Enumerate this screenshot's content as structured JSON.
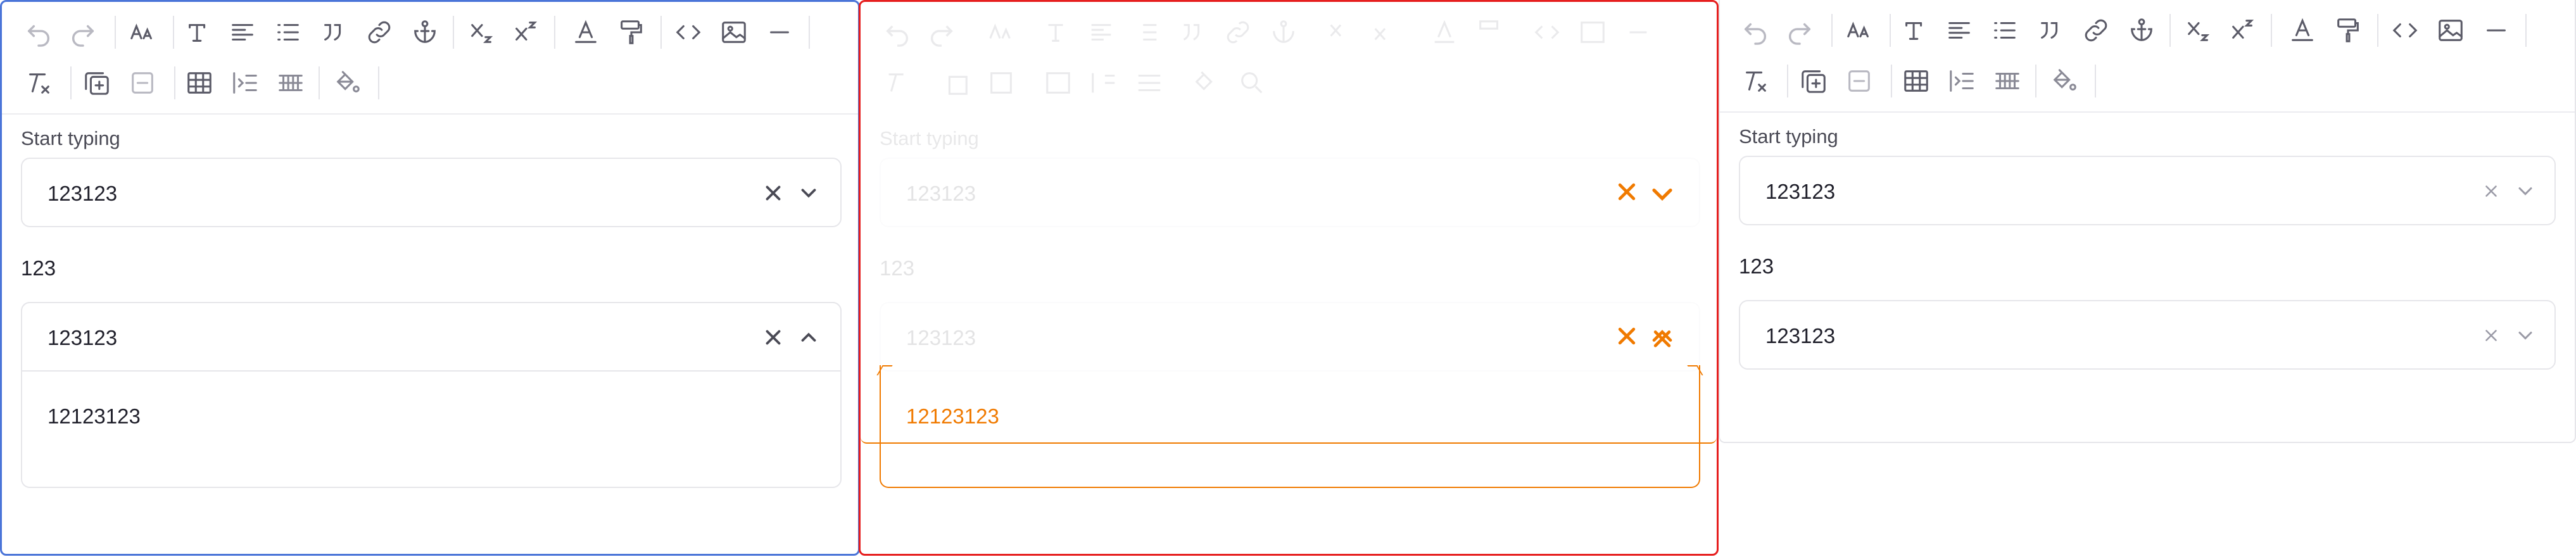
{
  "editor": {
    "toolbar_icons_row1": [
      "undo-icon",
      "redo-icon",
      "font-size-icon",
      "text-style-icon",
      "align-icon",
      "bullet-list-icon",
      "blockquote-icon",
      "link-icon",
      "anchor-icon",
      "subscript-icon",
      "superscript-icon",
      "text-color-icon",
      "format-painter-icon",
      "code-icon",
      "image-icon",
      "horizontal-rule-icon"
    ],
    "toolbar_icons_row2": [
      "clear-format-icon",
      "add-block-icon",
      "remove-block-icon",
      "table-icon",
      "indent-icon",
      "row-grid-icon",
      "fill-color-icon"
    ],
    "select_label": "Start typing",
    "select_value": "123123",
    "mid_text": "123",
    "second_value": "123123",
    "dropdown_option": "12123123"
  },
  "colors": {
    "accent_left": "#4a74d8",
    "accent_mid": "#e61e1e",
    "highlight_orange": "#f07a00"
  }
}
